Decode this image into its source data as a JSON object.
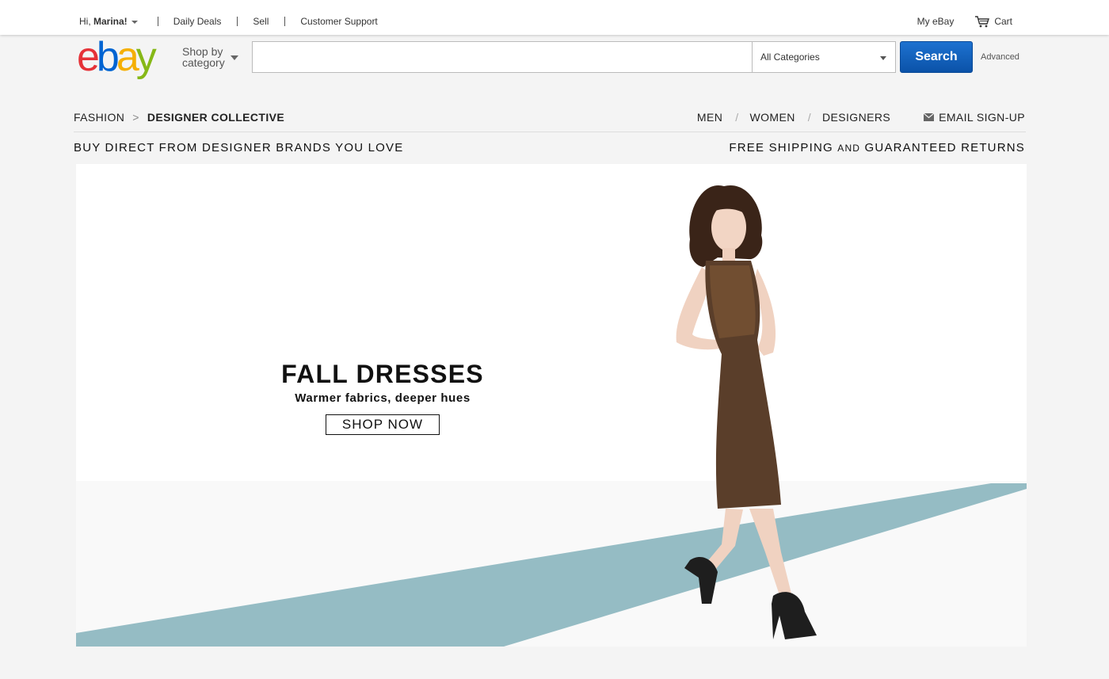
{
  "topbar": {
    "greeting_prefix": "Hi, ",
    "user_name": "Marina!",
    "links": [
      "Daily Deals",
      "Sell",
      "Customer Support"
    ],
    "my_ebay": "My eBay",
    "cart": "Cart"
  },
  "header": {
    "logo": {
      "e": "e",
      "b": "b",
      "a": "a",
      "y": "y"
    },
    "shop_by_line1": "Shop by",
    "shop_by_line2": "category",
    "search_value": "",
    "category_selected": "All Categories",
    "search_button": "Search",
    "advanced": "Advanced"
  },
  "breadcrumb": {
    "root": "FASHION",
    "separator": ">",
    "current": "DESIGNER COLLECTIVE"
  },
  "subnav": {
    "items": [
      "MEN",
      "WOMEN",
      "DESIGNERS"
    ],
    "separator": "/",
    "email_signup": "EMAIL SIGN-UP"
  },
  "tagline": {
    "left": "BUY DIRECT FROM DESIGNER BRANDS YOU LOVE",
    "right_part1": "FREE SHIPPING ",
    "right_and": "AND",
    "right_part2": " GUARANTEED RETURNS"
  },
  "hero": {
    "title": "FALL DRESSES",
    "subtitle": "Warmer fabrics, deeper hues",
    "cta": "SHOP NOW"
  },
  "colors": {
    "logo_e": "#e53238",
    "logo_b": "#0064d2",
    "logo_a": "#f5af02",
    "logo_y": "#86b817",
    "search_button": "#0b52a8",
    "runway": "#95bcc4",
    "dress": "#5a3e2a"
  },
  "icons": [
    "caret-down-icon",
    "cart-icon",
    "envelope-icon"
  ]
}
